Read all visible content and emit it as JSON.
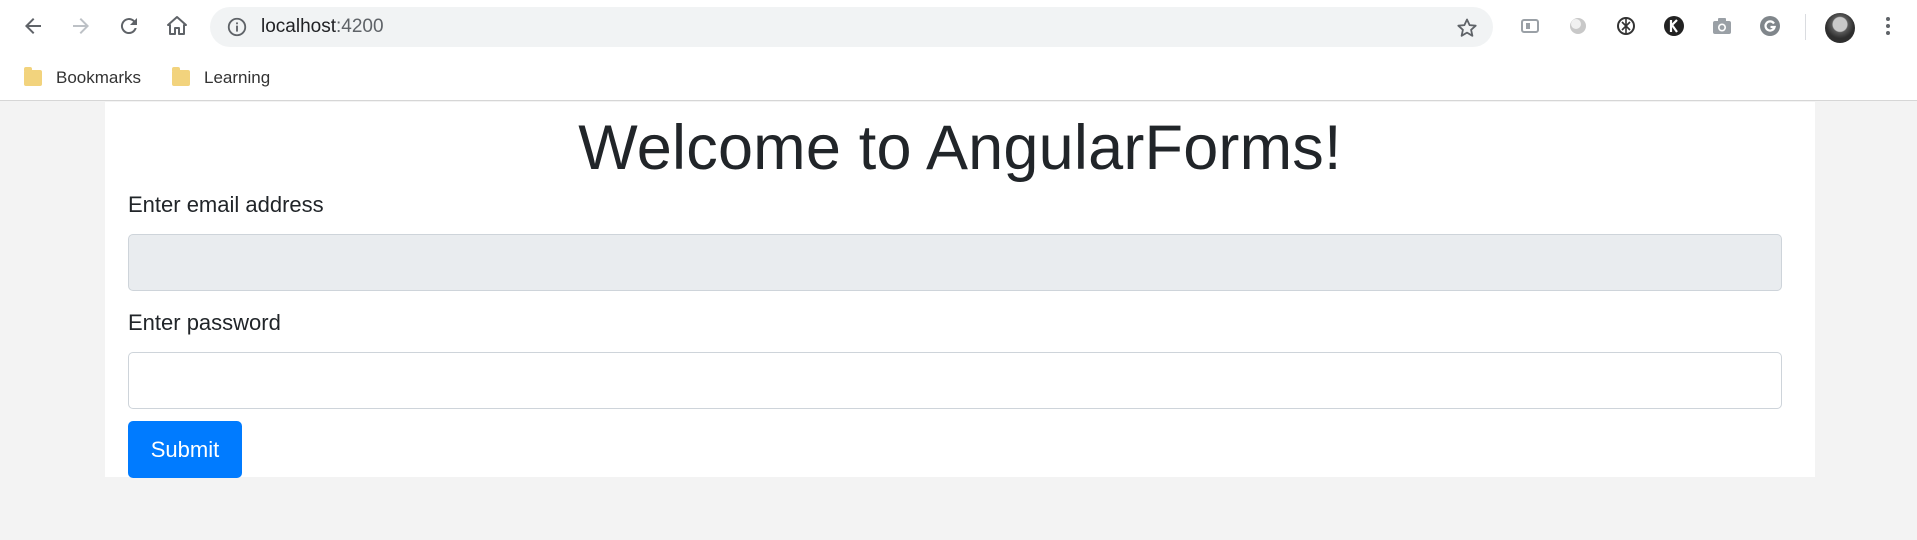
{
  "browser": {
    "url_host": "localhost",
    "url_port": ":4200",
    "bookmarks": [
      {
        "label": "Bookmarks"
      },
      {
        "label": "Learning"
      }
    ],
    "icons": {
      "back": "back-arrow-icon",
      "forward": "forward-arrow-icon",
      "reload": "reload-icon",
      "home": "home-icon",
      "info": "info-icon",
      "star": "star-icon",
      "menu": "kebab-menu-icon"
    }
  },
  "page": {
    "title": "Welcome to AngularForms!",
    "email_label": "Enter email address",
    "email_value": "",
    "password_label": "Enter password",
    "password_value": "",
    "submit_label": "Submit"
  },
  "colors": {
    "primary": "#007bff",
    "disabled_input": "#e9ecef",
    "page_bg": "#f3f3f3",
    "text": "#212529"
  }
}
